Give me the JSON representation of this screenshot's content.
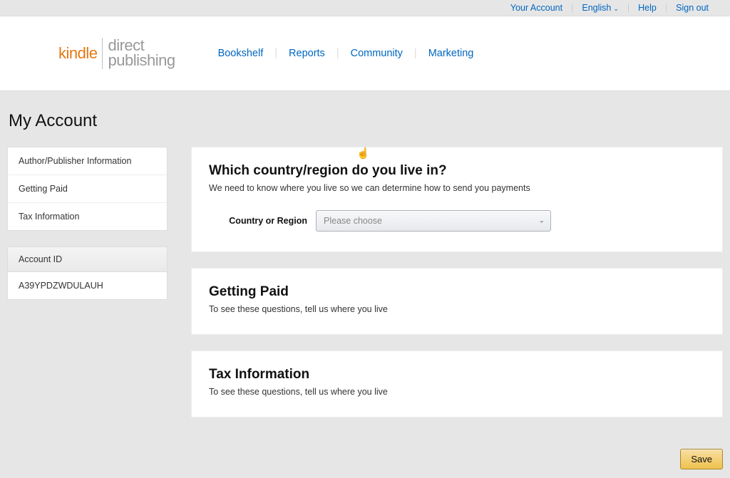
{
  "topbar": {
    "your_account": "Your Account",
    "language": "English",
    "help": "Help",
    "sign_out": "Sign out"
  },
  "logo": {
    "kindle": "kindle",
    "direct": "direct",
    "publishing": "publishing"
  },
  "nav": {
    "bookshelf": "Bookshelf",
    "reports": "Reports",
    "community": "Community",
    "marketing": "Marketing"
  },
  "page_title": "My Account",
  "sidebar": {
    "items": [
      "Author/Publisher Information",
      "Getting Paid",
      "Tax Information"
    ],
    "account_id_label": "Account ID",
    "account_id_value": "A39YPDZWDULAUH"
  },
  "country_card": {
    "title": "Which country/region do you live in?",
    "subtitle": "We need to know where you live so we can determine how to send you payments",
    "label": "Country or Region",
    "placeholder": "Please choose"
  },
  "getting_paid_card": {
    "title": "Getting Paid",
    "subtitle": "To see these questions, tell us where you live"
  },
  "tax_card": {
    "title": "Tax Information",
    "subtitle": "To see these questions, tell us where you live"
  },
  "save_button": "Save"
}
